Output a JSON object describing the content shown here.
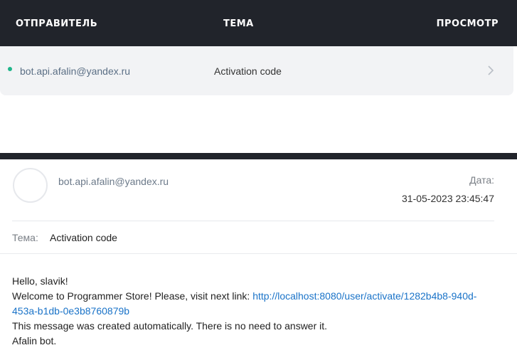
{
  "inbox": {
    "columns": {
      "sender": "ОТПРАВИТЕЛЬ",
      "subject": "ТЕМА",
      "preview": "ПРОСМОТР"
    },
    "rows": [
      {
        "sender": "bot.api.afalin@yandex.ru",
        "subject": "Activation code",
        "unread": true,
        "chevron_icon": "chevron-right-icon"
      }
    ]
  },
  "message": {
    "sender": "bot.api.afalin@yandex.ru",
    "date_label": "Дата:",
    "date_value": "31-05-2023 23:45:47",
    "subject_label": "Тема:",
    "subject_value": "Activation code",
    "body": {
      "greeting": "Hello, slavik!",
      "welcome_text": "Welcome to Programmer Store! Please, visit next link: ",
      "link_line1": "http://localhost:8080/user/activate/1282b4b8-940d-",
      "link_line2": "453a-b1db-0e3b8760879b",
      "auto_note": "This message was created automatically. There is no need to answer it.",
      "signature": "Afalin bot."
    }
  },
  "colors": {
    "header_bg": "#21242b",
    "row_bg": "#f2f3f5",
    "unread_dot": "#1fb58a",
    "link": "#1a73c8"
  }
}
